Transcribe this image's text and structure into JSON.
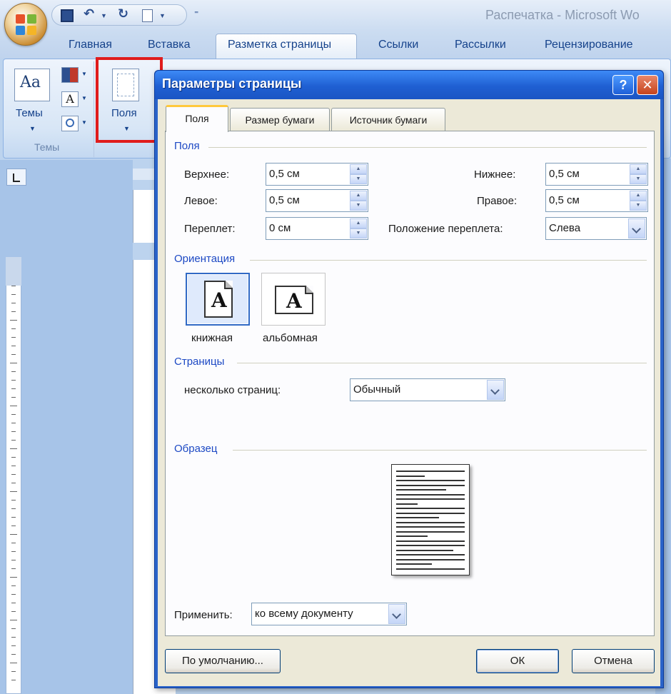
{
  "app": {
    "title": "Распечатка - Microsoft Wo"
  },
  "ribbon": {
    "tabs": [
      "Главная",
      "Вставка",
      "Разметка страницы",
      "Ссылки",
      "Рассылки",
      "Рецензирование"
    ],
    "active_tab": "Разметка страницы",
    "themes_button": "Темы",
    "themes_group": "Темы",
    "margins_button": "Поля"
  },
  "dialog": {
    "title": "Параметры страницы",
    "help": "?",
    "close": "✕",
    "tabs": {
      "margins": "Поля",
      "paper_size": "Размер бумаги",
      "paper_source": "Источник бумаги"
    },
    "margins_section": {
      "title": "Поля",
      "top_label": "Верхнее:",
      "top_value": "0,5 см",
      "bottom_label": "Нижнее:",
      "bottom_value": "0,5 см",
      "left_label": "Левое:",
      "left_value": "0,5 см",
      "right_label": "Правое:",
      "right_value": "0,5 см",
      "gutter_label": "Переплет:",
      "gutter_value": "0 см",
      "gutter_pos_label": "Положение переплета:",
      "gutter_pos_value": "Слева"
    },
    "orientation": {
      "title": "Ориентация",
      "portrait": "книжная",
      "landscape": "альбомная",
      "glyph": "A",
      "selected": "portrait"
    },
    "pages": {
      "title": "Страницы",
      "multiple_label": "несколько страниц:",
      "multiple_value": "Обычный"
    },
    "preview": {
      "title": "Образец"
    },
    "apply": {
      "label": "Применить:",
      "value": "ко всему документу"
    },
    "buttons": {
      "default": "По умолчанию...",
      "ok": "ОК",
      "cancel": "Отмена"
    }
  },
  "colors": {
    "accent": "#2a63c9",
    "section_title": "#1d49c4",
    "highlight": "#e01c1c"
  }
}
